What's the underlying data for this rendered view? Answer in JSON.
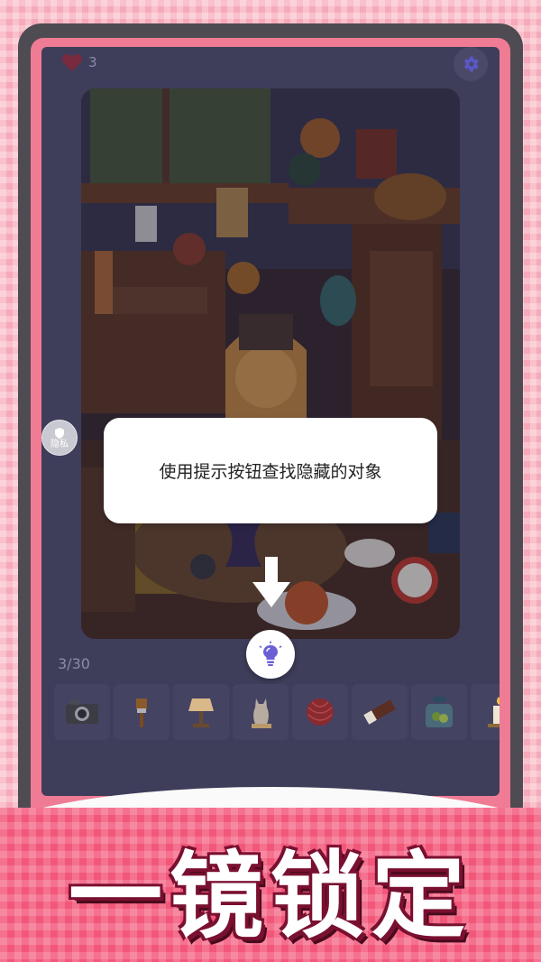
{
  "hud": {
    "lives": "3",
    "settings_icon": "gear-icon"
  },
  "sidebar": {
    "privacy_label": "隐私"
  },
  "tooltip": {
    "text": "使用提示按钮查找隐藏的对象"
  },
  "hint": {
    "icon": "lightbulb-icon"
  },
  "progress": {
    "text": "3/30"
  },
  "tray": {
    "items": [
      {
        "name": "camera"
      },
      {
        "name": "paintbrush"
      },
      {
        "name": "lamp"
      },
      {
        "name": "cat-statue"
      },
      {
        "name": "yarn-ball"
      },
      {
        "name": "chocolate-bar"
      },
      {
        "name": "jar"
      },
      {
        "name": "candle"
      }
    ]
  },
  "banner": {
    "slogan": "一镜锁定"
  },
  "colors": {
    "accent": "#f07b94",
    "screen": "#3e3d5a",
    "hint": "#6b5fd6"
  }
}
